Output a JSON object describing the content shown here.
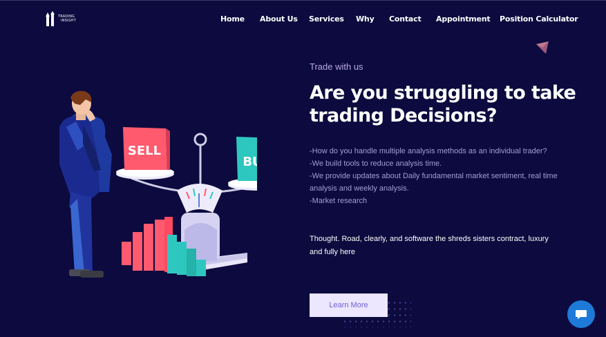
{
  "brand": {
    "line1": "TRADING",
    "line2": "INSIGHT"
  },
  "nav": {
    "items": [
      {
        "label": "Home"
      },
      {
        "label": "About Us"
      },
      {
        "label": "Services"
      },
      {
        "label": "Why"
      },
      {
        "label": "Contact"
      },
      {
        "label": "Appointment"
      },
      {
        "label": "Position Calculator"
      }
    ]
  },
  "hero": {
    "eyebrow": "Trade with us",
    "title": "Are you struggling to take trading Decisions?",
    "points": [
      "-How do you handle multiple analysis methods as an individual trader?",
      "-We build tools to reduce analysis time.",
      "-We provide updates about Daily fundamental market sentiment, real time analysis and weekly analysis.",
      "-Market research"
    ],
    "tagline": "Thought. Road, clearly, and software the shreds sisters contract, luxury and fully here",
    "cta": "Learn More"
  },
  "illustration": {
    "sell_label": "SELL",
    "buy_label": "BUY"
  },
  "icons": {
    "logo": "arrows-logo-icon",
    "chat": "chat-icon",
    "decor": "triangle-decor-icon"
  },
  "colors": {
    "background": "#0c0a3e",
    "sell": "#ff5a6e",
    "buy": "#2ec7c0",
    "cta_bg": "#ece6ff",
    "cta_text": "#6d5fd0",
    "chat": "#1e7ad8"
  }
}
